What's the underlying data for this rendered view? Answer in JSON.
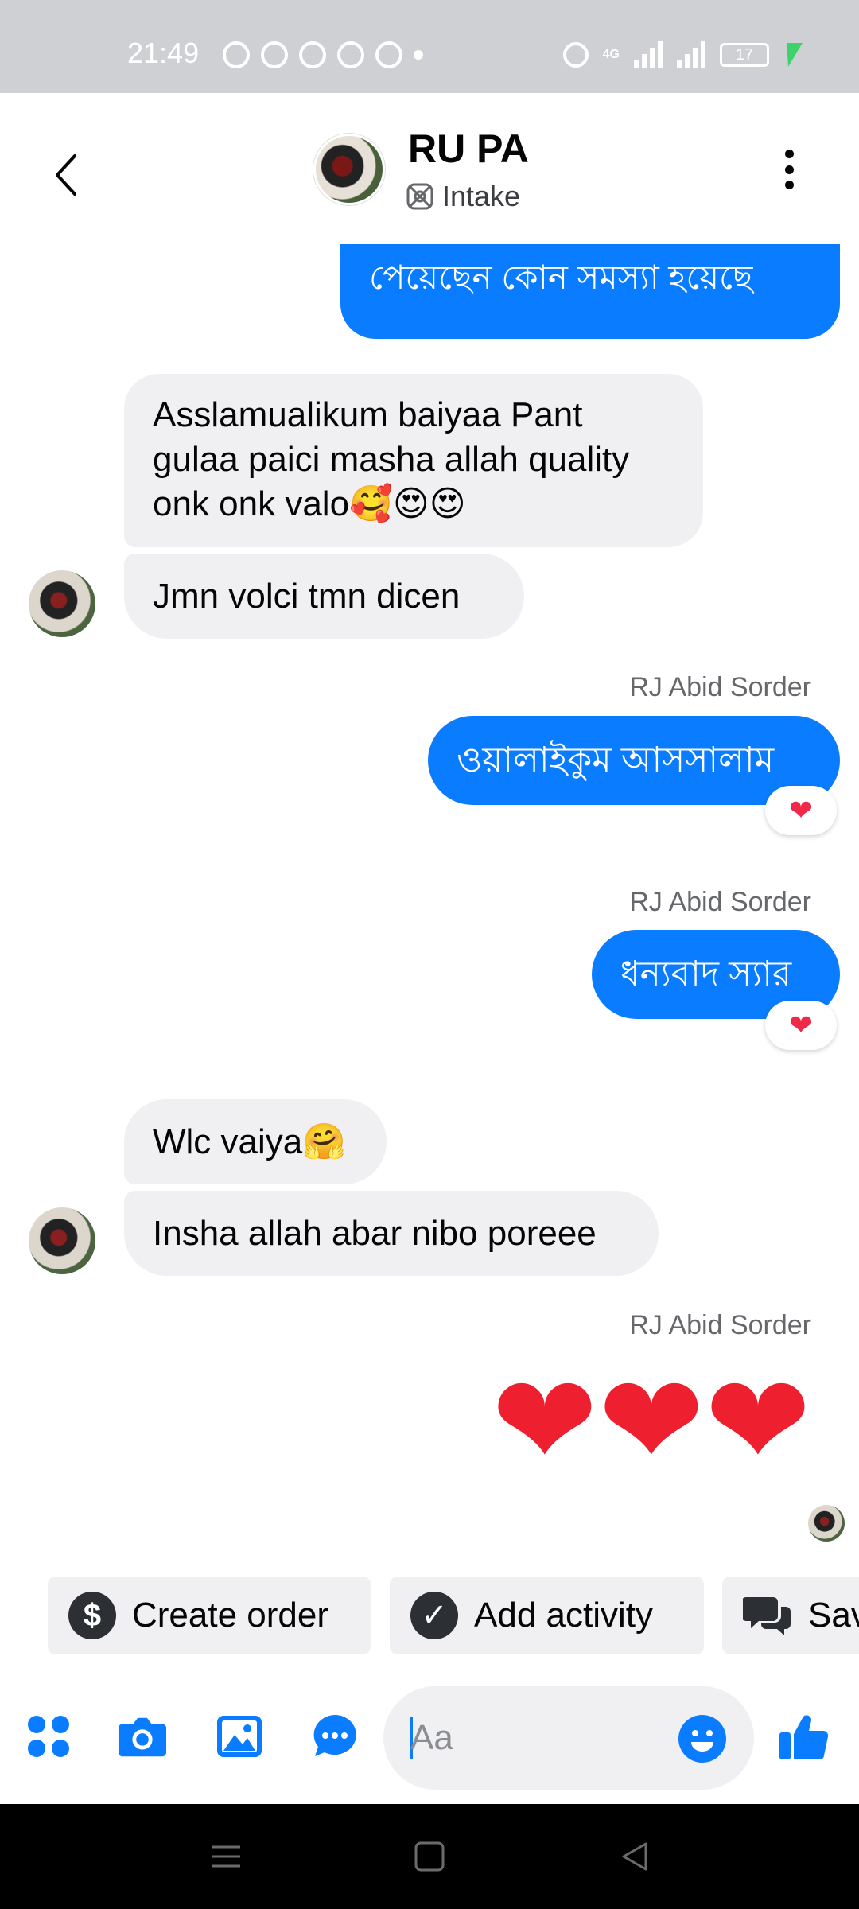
{
  "status_bar": {
    "time": "21:49",
    "network": "4G",
    "battery": "17"
  },
  "header": {
    "name": "RU PA",
    "subtitle": "Intake"
  },
  "messages": {
    "out_partial": "পেয়েছেন কোন সমস্যা হয়েছে",
    "in_1": "Asslamualikum  baiyaa Pant gulaa paici masha allah quality onk onk valo🥰😍😍",
    "in_2": "Jmn volci tmn dicen",
    "sender_1": "RJ Abid Sorder",
    "out_1": "ওয়ালাইকুম আসসালাম",
    "sender_2": "RJ Abid Sorder",
    "out_2": "ধন্যবাদ স্যার",
    "in_3": "Wlc vaiya🤗",
    "in_4": "Insha allah abar nibo poreee",
    "sender_3": "RJ Abid Sorder",
    "big_hearts": "❤❤❤",
    "reaction": "❤"
  },
  "quick_actions": {
    "create_order": "Create order",
    "add_activity": "Add activity",
    "saved": "Sav"
  },
  "composer": {
    "placeholder": "Aa"
  },
  "colors": {
    "brand_blue": "#0a7cff",
    "incoming_bg": "#f0f0f3",
    "heart_red": "#ee1f2f"
  }
}
